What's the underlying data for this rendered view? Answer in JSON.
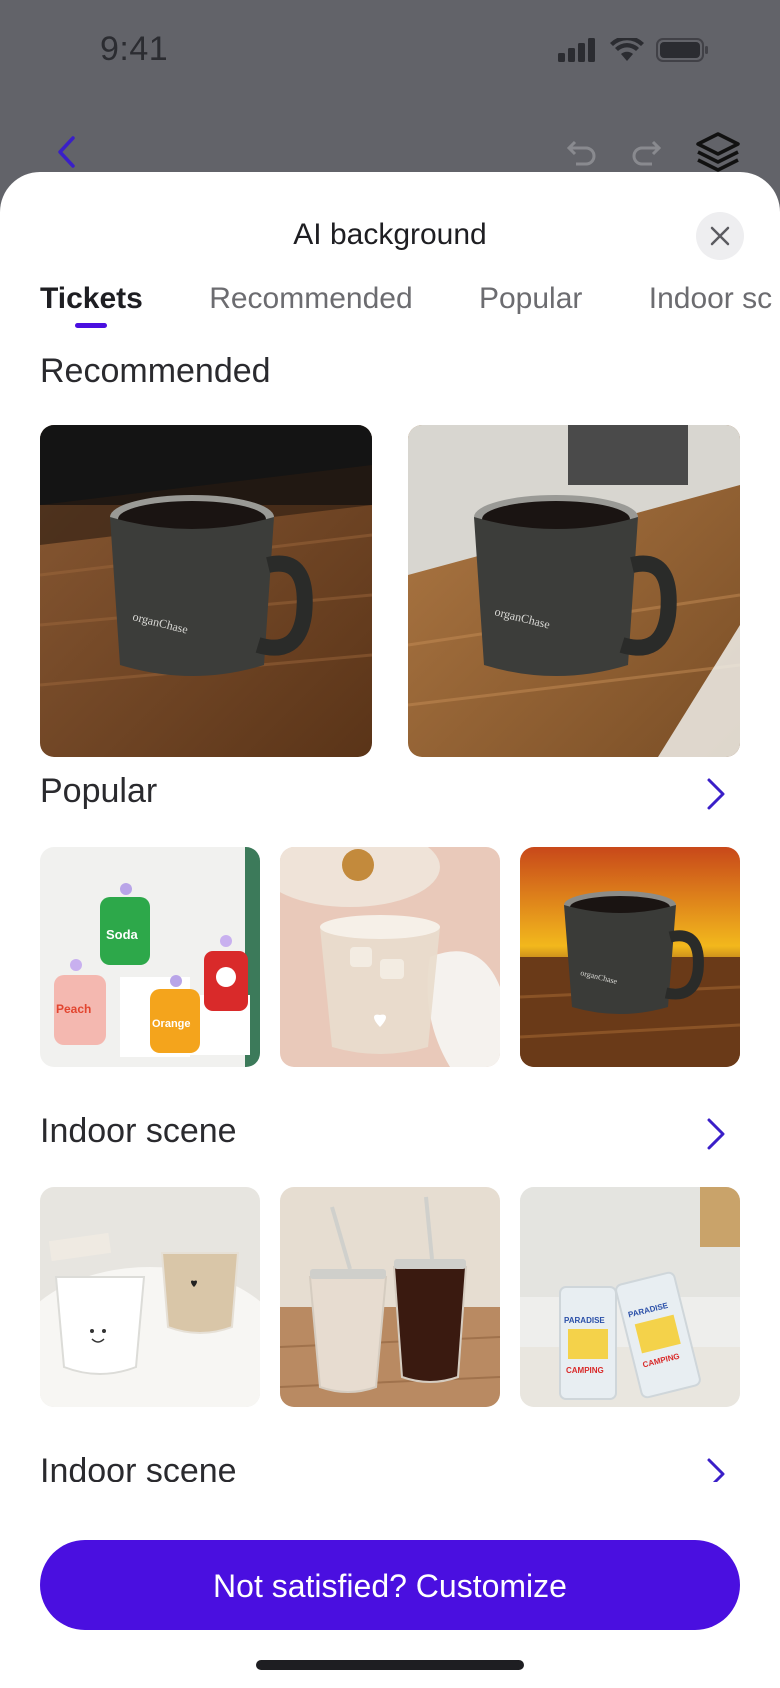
{
  "status_bar": {
    "time": "9:41"
  },
  "sheet": {
    "title": "AI background",
    "tabs": [
      "Tickets",
      "Recommended",
      "Popular",
      "Indoor sc"
    ],
    "active_tab": "Tickets",
    "sections": [
      {
        "title": "Recommended",
        "has_more": false,
        "items": [
          "mug-on-wooden-table",
          "mug-on-wooden-table-window"
        ]
      },
      {
        "title": "Popular",
        "has_more": true,
        "items": [
          "soda-can-bottles",
          "iced-latte-glass",
          "mug-at-sunset"
        ]
      },
      {
        "title": "Indoor scene",
        "has_more": true,
        "items": [
          "milk-glasses",
          "iced-coffee-tumblers",
          "paradise-camping-glasses"
        ]
      },
      {
        "title": "Indoor scene",
        "has_more": true,
        "items": []
      }
    ],
    "cta_label": "Not satisfied? Customize"
  },
  "thumb_text": {
    "mug_brand": "organChase",
    "soda": "Soda",
    "peach": "Peach",
    "orange": "Orange",
    "paradise": "PARADISE",
    "camping": "CAMPING"
  },
  "colors": {
    "accent": "#4a0fe0",
    "overlay": "#626369"
  }
}
